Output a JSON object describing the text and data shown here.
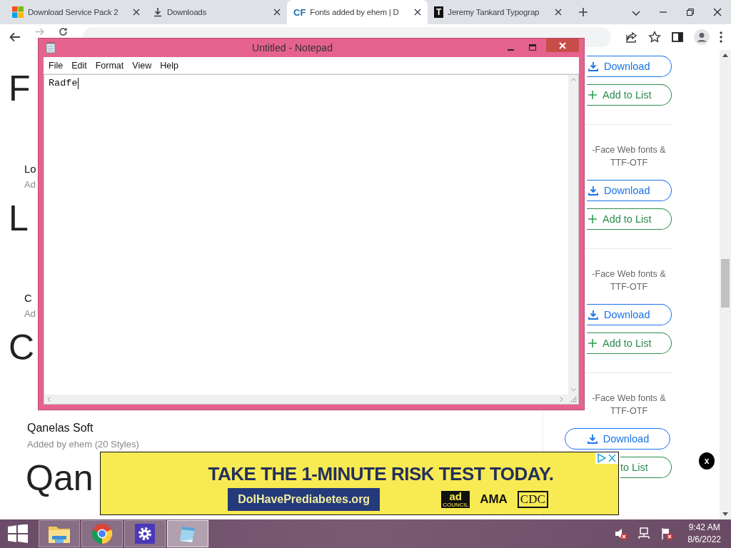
{
  "browser": {
    "tabs": [
      {
        "title": "Download Service Pack 2",
        "favicon": {
          "kind": "windows"
        },
        "selected": false
      },
      {
        "title": "Downloads",
        "favicon": {
          "kind": "download"
        },
        "selected": false
      },
      {
        "title": "Fonts added by ehem | D",
        "favicon": {
          "kind": "text",
          "text": "CF"
        },
        "selected": true
      },
      {
        "title": "Jeremy Tankard Typograp",
        "favicon": {
          "kind": "text",
          "text": "T"
        },
        "selected": false
      }
    ]
  },
  "page": {
    "font_entries": [
      {
        "sample": "F"
      },
      {
        "name": "Lo",
        "meta": "Ad",
        "sample": "L"
      },
      {
        "name": "C",
        "meta": "Ad",
        "sample": "C"
      },
      {
        "name": "Qanelas Soft",
        "meta": "Added by ehem (20 Styles)",
        "sample": "Qan"
      }
    ],
    "download_panels": [
      {
        "buttons": [
          {
            "kind": "download",
            "label": "Download"
          },
          {
            "kind": "add",
            "label": "Add to List"
          }
        ]
      },
      {
        "formats": [
          "-Face Web fonts &",
          "TTF-OTF"
        ],
        "buttons": [
          {
            "kind": "download",
            "label": "Download"
          },
          {
            "kind": "add",
            "label": "Add to List"
          }
        ]
      },
      {
        "formats": [
          "-Face Web fonts &",
          "TTF-OTF"
        ],
        "buttons": [
          {
            "kind": "download",
            "label": "Download"
          },
          {
            "kind": "add",
            "label": "Add to List"
          }
        ]
      },
      {
        "formats": [
          "-Face Web fonts &",
          "TTF-OTF"
        ],
        "buttons": [
          {
            "kind": "download",
            "label": "Download"
          },
          {
            "kind": "text",
            "label": "to List"
          }
        ]
      }
    ],
    "floating_close": "x"
  },
  "ad": {
    "headline": "TAKE THE 1-MINUTE RISK TEST TODAY.",
    "link": "DoIHavePrediabetes.org",
    "logos": [
      {
        "kind": "box",
        "text": "ad",
        "sub": "COUNCIL"
      },
      {
        "kind": "plain",
        "text": "AMA"
      },
      {
        "kind": "outline",
        "text": "CDC"
      }
    ]
  },
  "notepad": {
    "title": "Untitled - Notepad",
    "menu": [
      "File",
      "Edit",
      "Format",
      "View",
      "Help"
    ],
    "text": "Radfe"
  },
  "taskbar": {
    "apps": [
      {
        "kind": "explorer",
        "selected": false
      },
      {
        "kind": "chrome",
        "selected": false
      },
      {
        "kind": "settings",
        "selected": false
      },
      {
        "kind": "notepad",
        "selected": true
      }
    ],
    "time": "9:42 AM",
    "date": "8/6/2022"
  }
}
